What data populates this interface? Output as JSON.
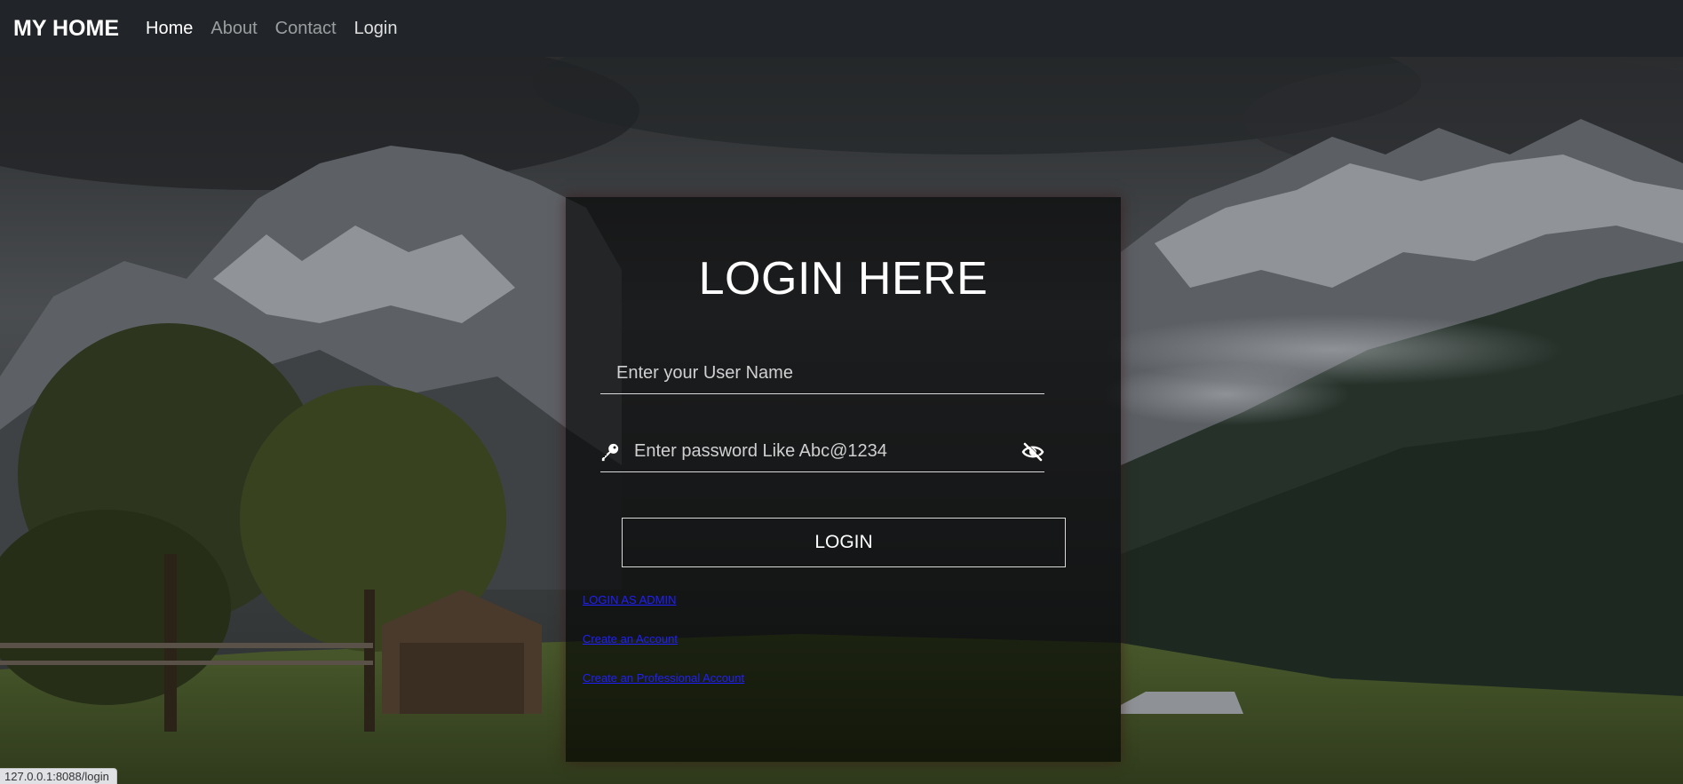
{
  "navbar": {
    "brand": "MY HOME",
    "links": [
      {
        "label": "Home"
      },
      {
        "label": "About"
      },
      {
        "label": "Contact"
      },
      {
        "label": "Login"
      }
    ]
  },
  "login_card": {
    "title": "LOGIN HERE",
    "username_placeholder": "Enter your User Name",
    "password_placeholder": "Enter password Like Abc@1234",
    "login_button": "LOGIN",
    "links": {
      "admin": "LOGIN AS ADMIN",
      "create_account": "Create an Account",
      "create_professional": "Create an Professional Account"
    }
  },
  "status_bar": {
    "url": "127.0.0.1:8088/login"
  },
  "icons": {
    "password_prefix": "key-icon",
    "password_toggle": "eye-slash-icon"
  },
  "colors": {
    "navbar_bg": "#212529",
    "link_blue": "#1f1fff",
    "card_bg": "rgba(0,0,0,0.62)"
  }
}
